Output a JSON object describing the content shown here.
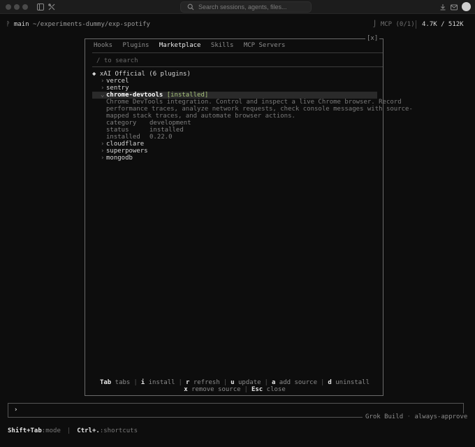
{
  "titlebar": {
    "search_placeholder": "Search sessions, agents, files..."
  },
  "status": {
    "branch": "main",
    "path": "~/experiments-dummy/exp-spotify",
    "mcp": "MCP (0/1)",
    "tokens": "4.7K / 512K"
  },
  "modal": {
    "close": "[x]",
    "tabs": [
      "Hooks",
      "Plugins",
      "Marketplace",
      "Skills",
      "MCP Servers"
    ],
    "active_tab": "Marketplace",
    "filter_placeholder": "/ to search",
    "group": {
      "marker": "◆",
      "label": "xAI Official (6 plugins)"
    },
    "plugins": [
      {
        "name": "vercel"
      },
      {
        "name": "sentry"
      },
      {
        "name": "chrome-devtools",
        "badge": "[installed]",
        "selected": true,
        "description": [
          "Chrome DevTools integration. Control and inspect a live Chrome browser. Record",
          "performance traces, analyze network requests, check console messages with source-",
          "mapped stack traces, and automate browser actions."
        ],
        "details": [
          {
            "key": "category",
            "value": "development"
          },
          {
            "key": "status",
            "value": "installed"
          },
          {
            "key": "installed",
            "value": "0.22.0"
          }
        ]
      },
      {
        "name": "cloudflare"
      },
      {
        "name": "superpowers"
      },
      {
        "name": "mongodb"
      }
    ],
    "shortcuts_row1": [
      {
        "key": "Tab",
        "label": "tabs"
      },
      {
        "key": "i",
        "label": "install"
      },
      {
        "key": "r",
        "label": "refresh"
      },
      {
        "key": "u",
        "label": "update"
      },
      {
        "key": "a",
        "label": "add source"
      },
      {
        "key": "d",
        "label": "uninstall"
      }
    ],
    "shortcuts_row2": [
      {
        "key": "x",
        "label": "remove source"
      },
      {
        "key": "Esc",
        "label": "close"
      }
    ]
  },
  "prompt": {
    "caret": "›",
    "build_name": "Grok Build",
    "build_sep": "·",
    "build_mode": "always-approve"
  },
  "bottom": {
    "mode_key": "Shift+Tab",
    "mode_label": ":mode",
    "shortcut_key": "Ctrl+.",
    "shortcut_label": ":shortcuts"
  }
}
